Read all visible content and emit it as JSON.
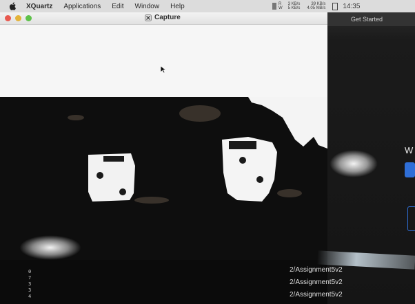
{
  "menubar": {
    "app_name": "XQuartz",
    "menus": [
      "Applications",
      "Edit",
      "Window",
      "Help"
    ],
    "status": {
      "disk_r": "R",
      "disk_w": "W",
      "disk_read": "3 KB/s",
      "disk_write": "5 KB/s",
      "net_down": "39 KB/s",
      "net_up": "4.05 MB/s",
      "clock": "14:35"
    }
  },
  "window": {
    "title": "Capture"
  },
  "right_app": {
    "header": "Get Started",
    "heading_fragment": "W"
  },
  "below": {
    "line_numbers": [
      "0",
      "7",
      "3",
      "3",
      "4"
    ],
    "files": [
      "2/Assignment5v2",
      "2/Assignment5v2",
      "2/Assignment5v2"
    ]
  }
}
